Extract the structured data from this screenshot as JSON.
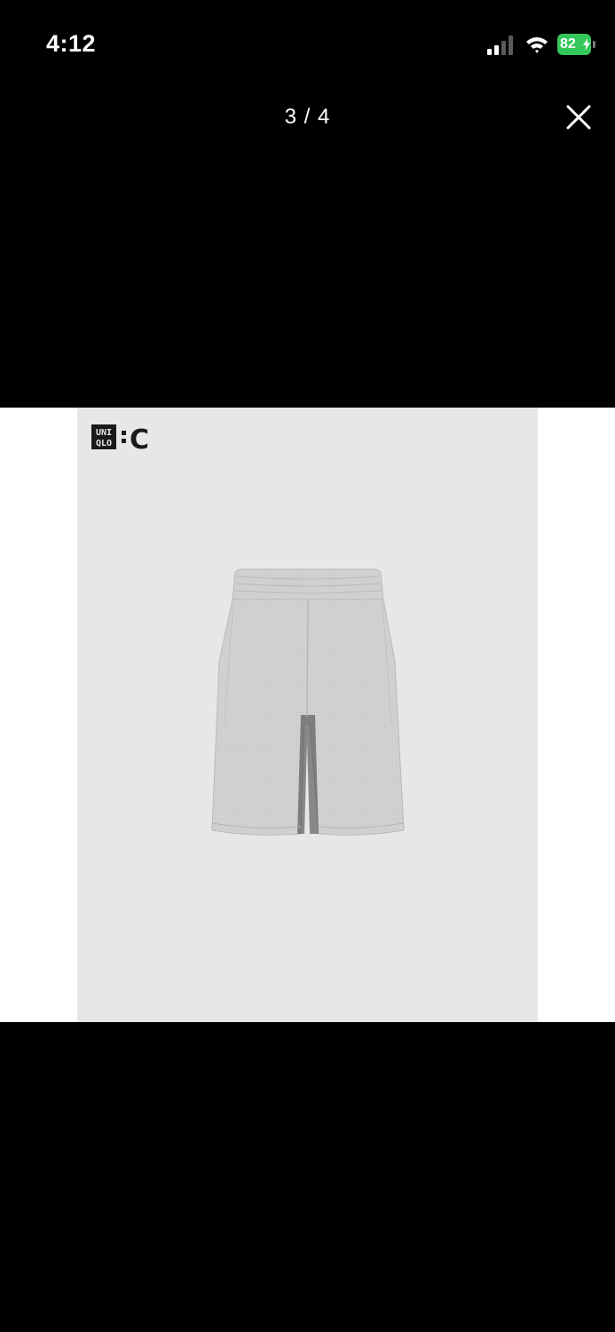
{
  "status_bar": {
    "time": "4:12",
    "battery_percent": "82",
    "icons": [
      "signal-icon",
      "wifi-icon",
      "battery-icon",
      "charging-bolt-icon"
    ],
    "battery_color": "#34c759"
  },
  "viewer": {
    "counter": "3 / 4",
    "close_icon": "close-icon"
  },
  "image": {
    "brand_logo_text": [
      "UNI",
      "QLO",
      "C"
    ],
    "background_color": "#e6e7e9"
  }
}
